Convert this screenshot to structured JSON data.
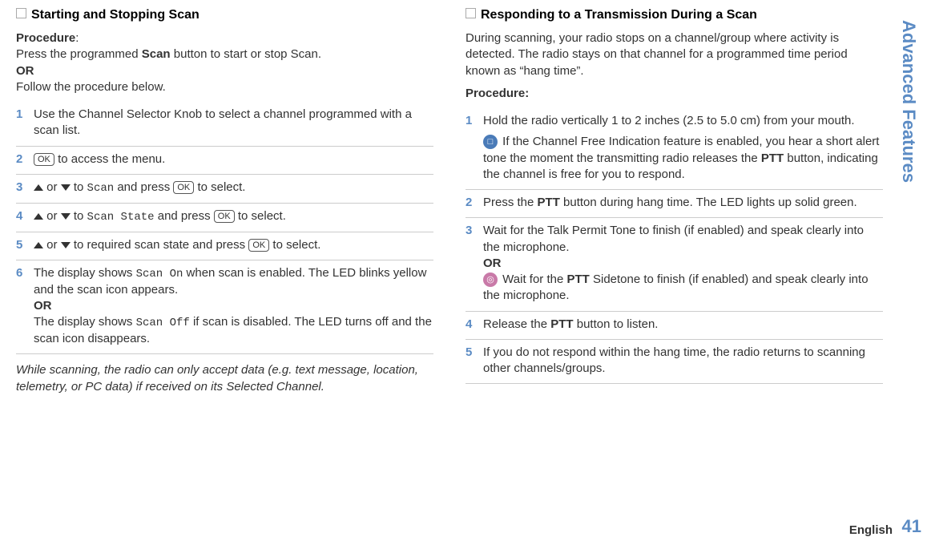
{
  "sidebar": {
    "title": "Advanced Features",
    "page": "41",
    "lang": "English"
  },
  "left": {
    "title": "Starting and Stopping Scan",
    "procLabel": "Procedure",
    "intro1": "Press the programmed ",
    "intro1b": "Scan",
    "intro1c": " button to start or stop Scan.",
    "or": "OR",
    "intro2": "Follow the procedure below.",
    "steps": {
      "s1": "Use the Channel Selector Knob to select a channel programmed with a scan list.",
      "s2a": " to access the menu.",
      "s3a": " or ",
      "s3b": " to ",
      "s3c": "Scan",
      "s3d": " and press ",
      "s3e": " to select.",
      "s4c": "Scan State",
      "s5b": " to required scan state and press ",
      "s6a": "The display shows ",
      "s6b": "Scan On",
      "s6c": " when scan is enabled. The LED blinks yellow and the scan icon appears.",
      "s6or": "OR",
      "s6d": "The display shows ",
      "s6e": "Scan Off",
      "s6f": " if scan is disabled. The LED turns off and the scan icon disappears."
    },
    "note": "While scanning, the radio can only accept data (e.g. text message, location, telemetry, or PC data) if received on its Selected Channel."
  },
  "right": {
    "title": "Responding to a Transmission During a Scan",
    "intro": "During scanning, your radio stops on a channel/group where activity is detected. The radio stays on that channel for a programmed time period known as “hang time”.",
    "procLabel": "Procedure:",
    "steps": {
      "s1a": "Hold the radio vertically 1 to 2 inches (2.5 to 5.0 cm) from your mouth.",
      "s1b": " If the Channel Free Indication feature is enabled, you hear a short alert tone the moment the transmitting radio releases the ",
      "s1c": "PTT",
      "s1d": " button, indicating the channel is free for you to respond.",
      "s2a": "Press the ",
      "s2b": "PTT",
      "s2c": " button during hang time. The LED lights up solid green.",
      "s3a": "Wait for the Talk Permit Tone to finish (if enabled) and speak clearly into the microphone.",
      "s3or": "OR",
      "s3b": " Wait for the ",
      "s3c": "PTT",
      "s3d": " Sidetone to finish (if enabled) and speak clearly into the microphone.",
      "s4a": "Release the ",
      "s4b": "PTT",
      "s4c": " button to listen.",
      "s5": "If you do not respond within the hang time, the radio returns to scanning other channels/groups."
    }
  },
  "nums": {
    "n1": "1",
    "n2": "2",
    "n3": "3",
    "n4": "4",
    "n5": "5",
    "n6": "6"
  },
  "key": {
    "ok": "OK"
  },
  "icon": {
    "blue": "□",
    "pink": "◎"
  }
}
